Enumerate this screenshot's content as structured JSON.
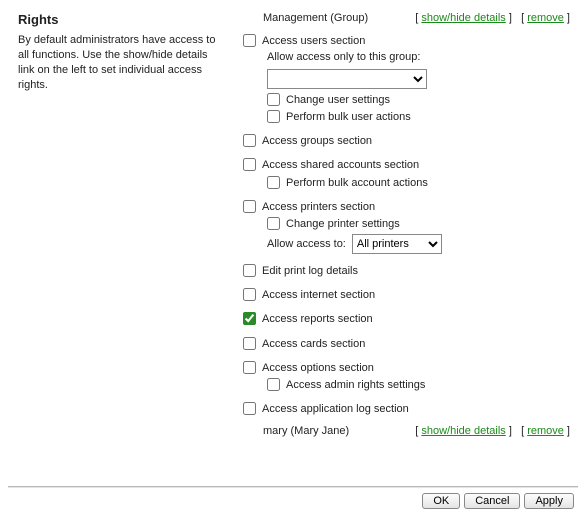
{
  "left": {
    "title": "Rights",
    "desc": "By default administrators have access to all functions. Use the show/hide details link on the left to set individual access rights."
  },
  "entities": {
    "group": {
      "name": "Management (Group)"
    },
    "user": {
      "name": "mary (Mary Jane)"
    },
    "show_hide": "show/hide details",
    "remove": "remove",
    "lb": "[ ",
    "rb": " ]"
  },
  "perm": {
    "users": {
      "label": "Access users section",
      "hint": "Allow access only to this group:",
      "change_settings": "Change user settings",
      "bulk": "Perform bulk user actions"
    },
    "groups": {
      "label": "Access groups section"
    },
    "shared": {
      "label": "Access shared accounts section",
      "bulk": "Perform bulk account actions"
    },
    "printers": {
      "label": "Access printers section",
      "change": "Change printer settings",
      "access_to_label": "Allow access to:",
      "selected": "All printers"
    },
    "editlog": {
      "label": "Edit print log details"
    },
    "internet": {
      "label": "Access internet section"
    },
    "reports": {
      "label": "Access reports section"
    },
    "cards": {
      "label": "Access cards section"
    },
    "options": {
      "label": "Access options section",
      "admin": "Access admin rights settings"
    },
    "applog": {
      "label": "Access application log section"
    }
  },
  "footer": {
    "ok": "OK",
    "cancel": "Cancel",
    "apply": "Apply"
  }
}
